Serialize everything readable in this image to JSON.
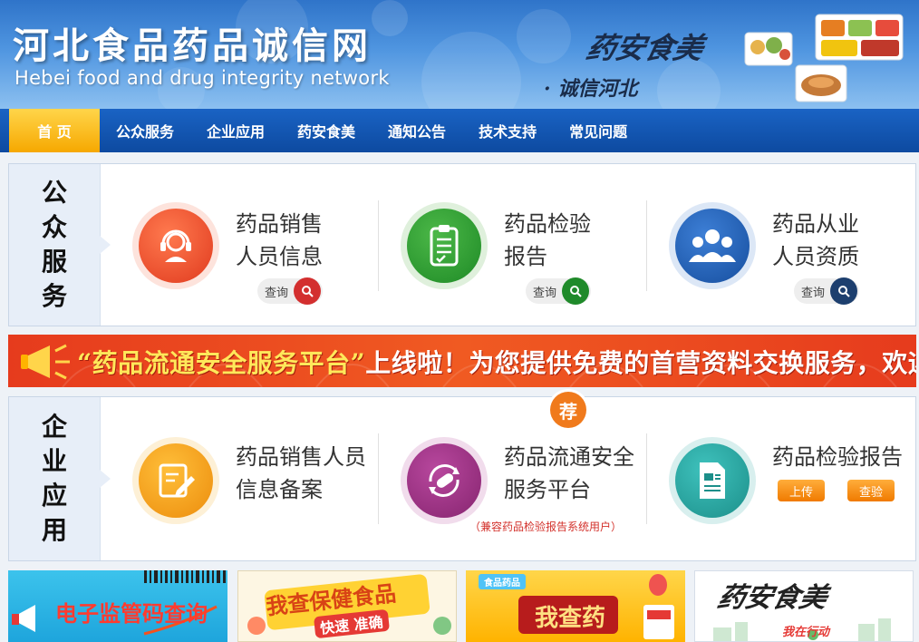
{
  "header": {
    "title": "河北食品药品诚信网",
    "subtitle": "Hebei food and drug integrity network",
    "calligraphy": "药安食美",
    "slogan": "· 诚信河北"
  },
  "nav": {
    "items": [
      {
        "label": "首 页",
        "active": true
      },
      {
        "label": "公众服务"
      },
      {
        "label": "企业应用"
      },
      {
        "label": "药安食美"
      },
      {
        "label": "通知公告"
      },
      {
        "label": "技术支持"
      },
      {
        "label": "常见问题"
      }
    ]
  },
  "public_service": {
    "side": [
      "公",
      "众",
      "服",
      "务"
    ],
    "items": [
      {
        "line1": "药品销售",
        "line2": "人员信息",
        "button": "查询",
        "color": "#e8452c",
        "btn_color": "#d32f2f",
        "icon": "headset-icon"
      },
      {
        "line1": "药品检验",
        "line2": "报告",
        "button": "查询",
        "color": "#2a9a33",
        "btn_color": "#1f8a2a",
        "icon": "clipboard-icon"
      },
      {
        "line1": "药品从业",
        "line2": "人员资质",
        "button": "查询",
        "color": "#1e5fb3",
        "btn_color": "#1d3f6e",
        "icon": "users-icon"
      }
    ]
  },
  "banner": {
    "part1": "“药品流通安全服务平台”",
    "part2": "上线啦！为您提供免费的首营资料交换服务，欢迎使用！"
  },
  "enterprise": {
    "side": [
      "企",
      "业",
      "应",
      "用"
    ],
    "badge": "荐",
    "items": [
      {
        "line1": "药品销售人员",
        "line2": "信息备案",
        "color": "#f1a21c",
        "icon": "edit-icon"
      },
      {
        "line1": "药品流通安全",
        "line2": "服务平台",
        "note": "（兼容药品检验报告系统用户）",
        "color": "#9b2f86",
        "icon": "pill-icon"
      },
      {
        "line1": "药品检验报告",
        "upload": "上传",
        "check": "查验",
        "color": "#27a8a3",
        "icon": "document-icon"
      }
    ]
  },
  "tiles": [
    {
      "text": "电子监管码查询"
    },
    {
      "text1": "我查保健食品",
      "text2": "快速 准确"
    },
    {
      "small": "食品药品",
      "text": "我查药"
    },
    {
      "text": "药安食美",
      "sub": "我在行动"
    }
  ]
}
